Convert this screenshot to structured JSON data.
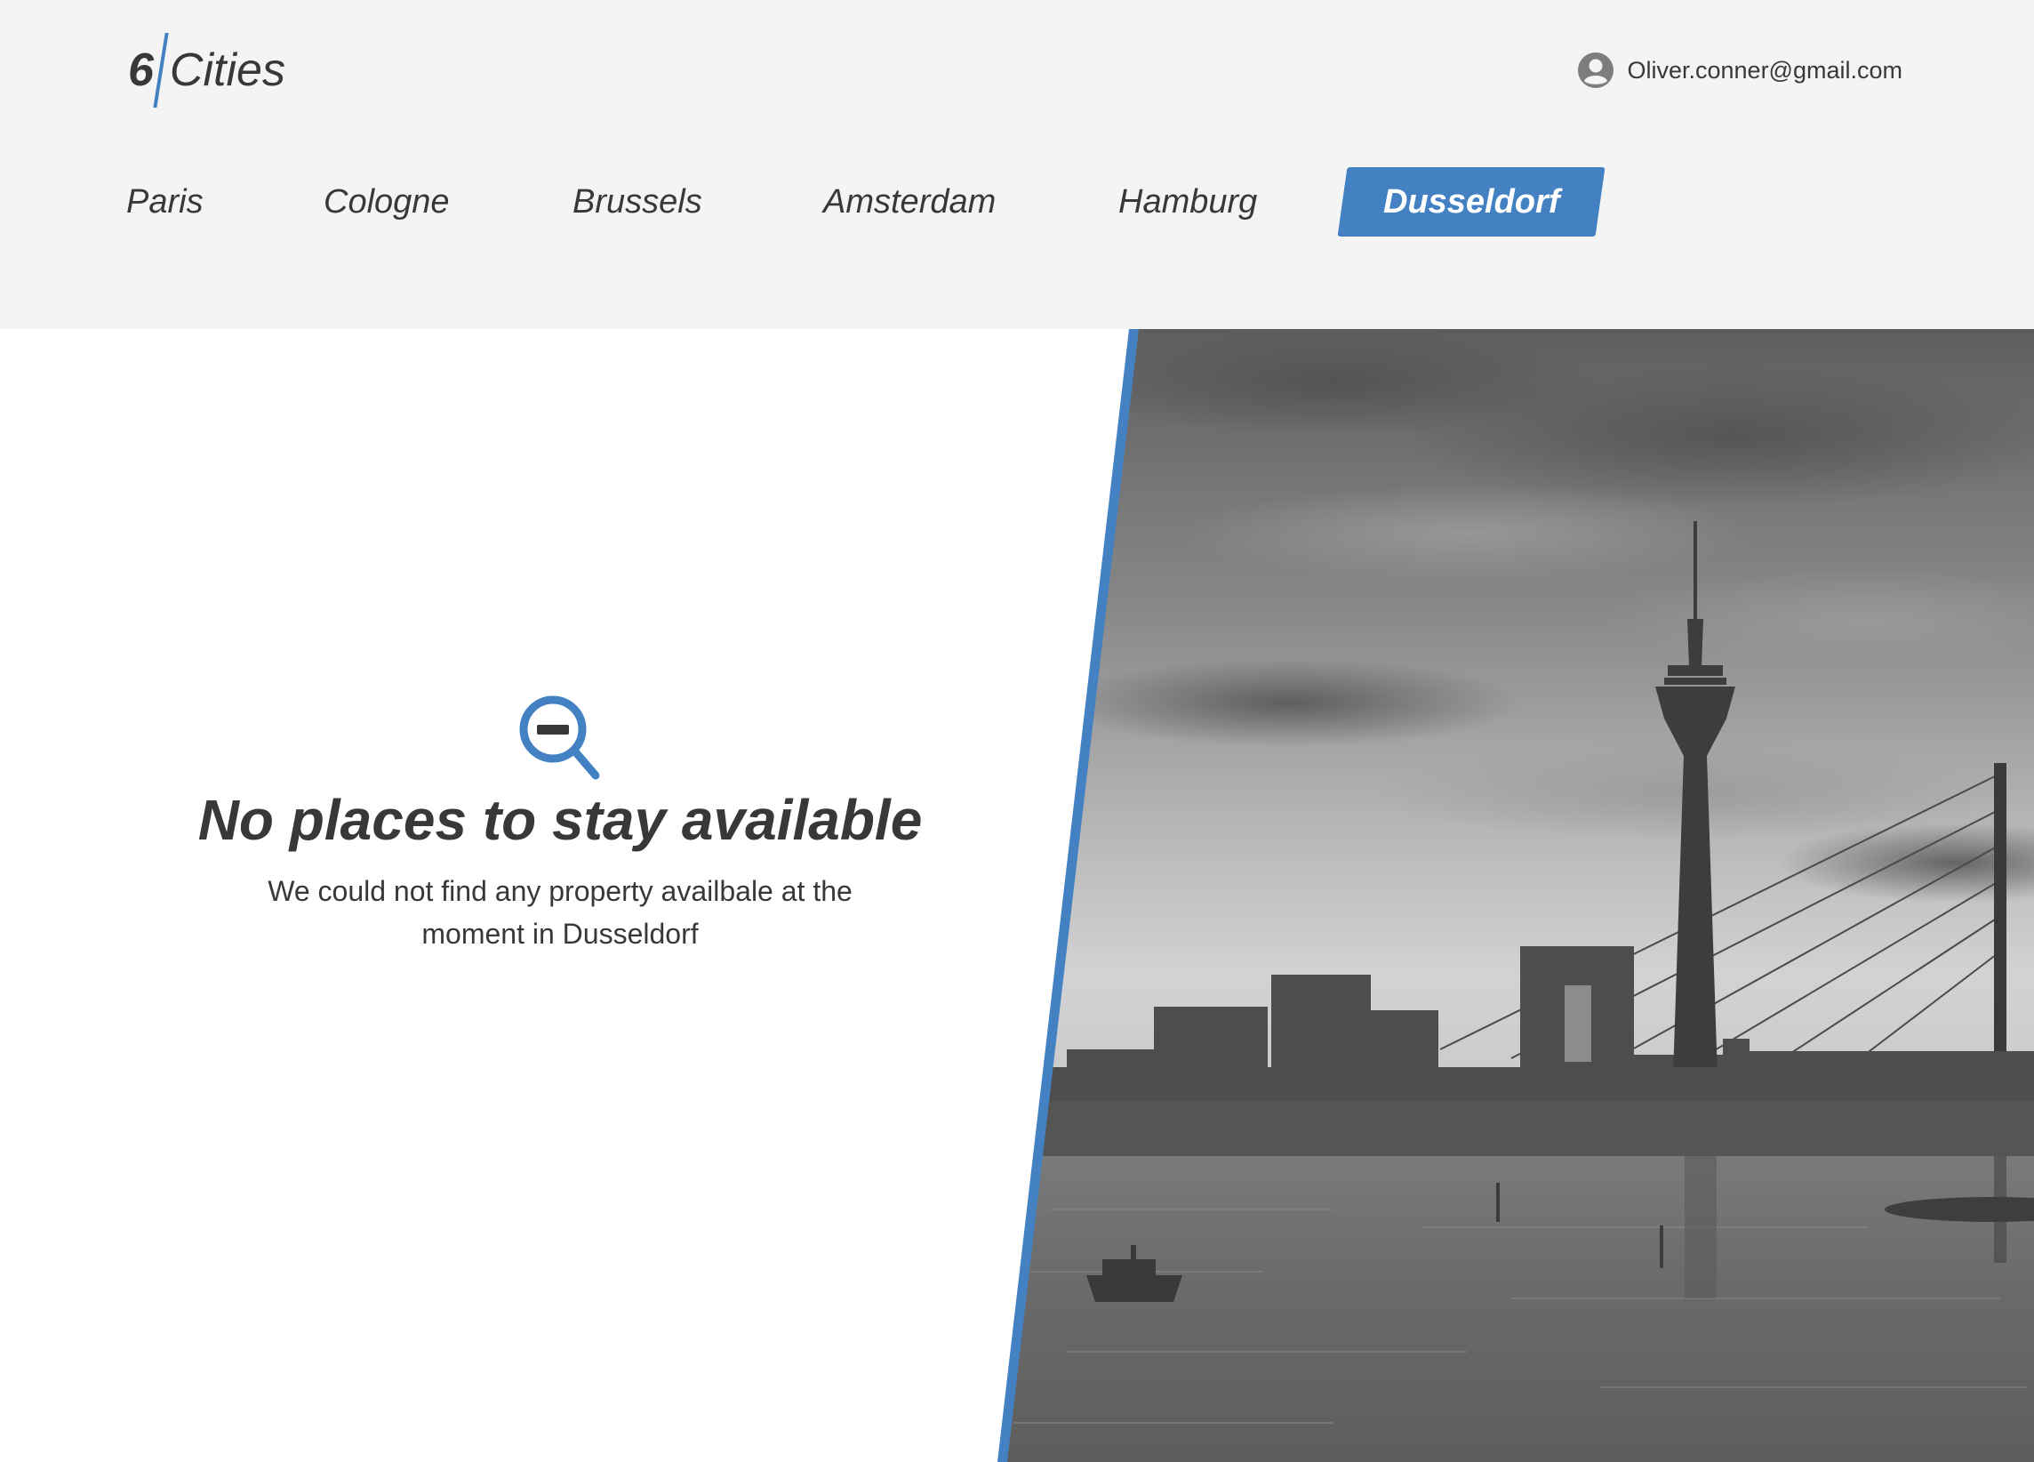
{
  "header": {
    "logo": {
      "number": "6",
      "word": "Cities"
    },
    "user": {
      "email": "Oliver.conner@gmail.com",
      "icon": "user-circle-icon"
    }
  },
  "tabs": [
    {
      "label": "Paris",
      "active": false
    },
    {
      "label": "Cologne",
      "active": false
    },
    {
      "label": "Brussels",
      "active": false
    },
    {
      "label": "Amsterdam",
      "active": false
    },
    {
      "label": "Hamburg",
      "active": false
    },
    {
      "label": "Dusseldorf",
      "active": true
    }
  ],
  "empty_state": {
    "icon": "search-minus-icon",
    "title": "No places to stay available",
    "message": "We could not find any property availbale at the moment in Dusseldorf"
  },
  "colors": {
    "accent": "#4481c3",
    "text": "#383838",
    "header_bg": "#f4f4f4"
  }
}
